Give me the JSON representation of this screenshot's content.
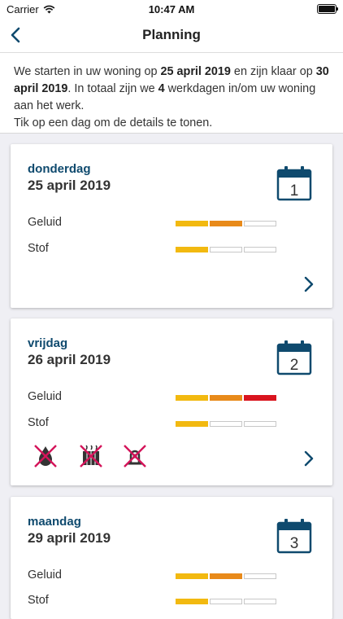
{
  "status_bar": {
    "carrier": "Carrier",
    "time": "10:47 AM"
  },
  "nav": {
    "title": "Planning"
  },
  "intro": {
    "s1": "We starten in uw woning op ",
    "start_date": "25 april 2019",
    "s2": " en zijn klaar op ",
    "end_date": "30 april 2019",
    "s3": ". In totaal zijn we ",
    "days": "4",
    "s4": " werkdagen in/om uw woning aan het werk.",
    "hint": "Tik op een dag om de details te tonen."
  },
  "cards": [
    {
      "weekday": "donderdag",
      "date": "25 april 2019",
      "day_number": "1",
      "noise_label": "Geluid",
      "noise_level": 2,
      "dust_label": "Stof",
      "dust_level": 1,
      "restrictions": []
    },
    {
      "weekday": "vrijdag",
      "date": "26 april 2019",
      "day_number": "2",
      "noise_label": "Geluid",
      "noise_level": 3,
      "dust_label": "Stof",
      "dust_level": 1,
      "restrictions": [
        "no-water-icon",
        "no-heating-icon",
        "no-gas-icon"
      ]
    },
    {
      "weekday": "maandag",
      "date": "29 april 2019",
      "day_number": "3",
      "noise_label": "Geluid",
      "noise_level": 2,
      "dust_label": "Stof",
      "dust_level": 1,
      "restrictions": []
    }
  ],
  "colors": {
    "primary": "#0f4a6e",
    "level1": "#f2b910",
    "level2": "#e88a1a",
    "level3": "#d9141e",
    "restriction": "#d4145a"
  }
}
